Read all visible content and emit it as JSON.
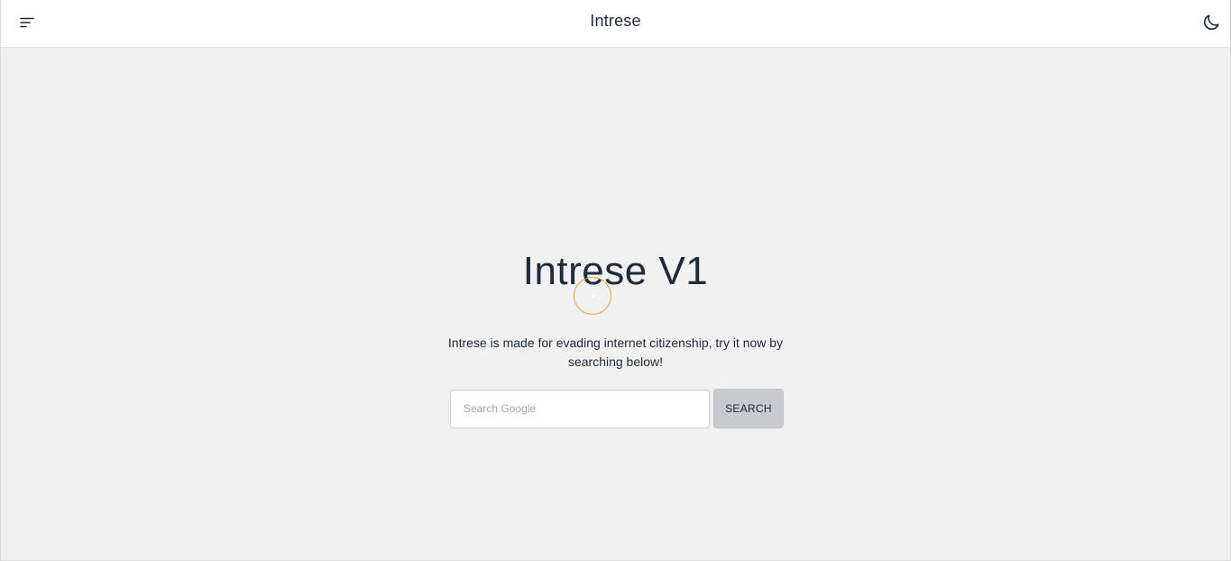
{
  "header": {
    "title": "Intrese",
    "menu_icon": "menu-icon",
    "theme_icon": "moon-icon"
  },
  "hero": {
    "title": "Intrese V1",
    "description": "Intrese is made for evading internet citizenship, try it now by searching below!"
  },
  "search": {
    "placeholder": "Search Google",
    "value": "",
    "button_label": "SEARCH"
  },
  "colors": {
    "background": "#f1f1f1",
    "topbar": "#ffffff",
    "text": "#1f2937",
    "button": "#c9cacd",
    "cursor_ring": "#d9a441"
  }
}
